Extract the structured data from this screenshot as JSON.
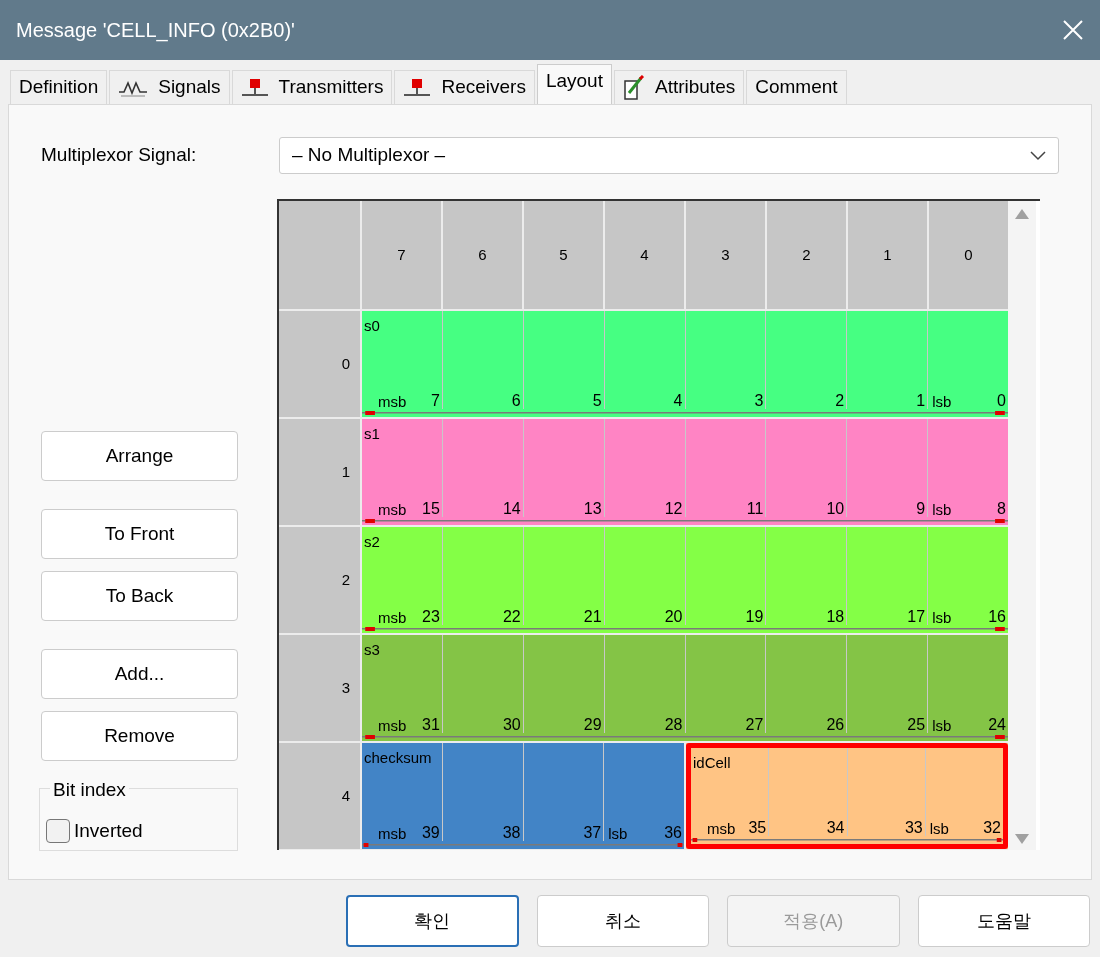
{
  "window": {
    "title": "Message 'CELL_INFO (0x2B0)'"
  },
  "tabs": [
    {
      "label": "Definition",
      "kind": "plain",
      "selected": false
    },
    {
      "label": "Signals",
      "kind": "signal",
      "selected": false
    },
    {
      "label": "Transmitters",
      "kind": "node",
      "selected": false
    },
    {
      "label": "Receivers",
      "kind": "node",
      "selected": false
    },
    {
      "label": "Layout",
      "kind": "plain",
      "selected": true
    },
    {
      "label": "Attributes",
      "kind": "attribute",
      "selected": false
    },
    {
      "label": "Comment",
      "kind": "plain",
      "selected": false
    }
  ],
  "multiplexor": {
    "label": "Multiplexor Signal:",
    "value": "– No Multiplexor –"
  },
  "action_groups": [
    [
      "Arrange"
    ],
    [
      "To Front",
      "To Back"
    ],
    [
      "Add...",
      "Remove"
    ]
  ],
  "bit_index": {
    "title": "Bit index",
    "inverted_label": "Inverted",
    "inverted": false
  },
  "layout": {
    "column_headers": [
      "7",
      "6",
      "5",
      "4",
      "3",
      "2",
      "1",
      "0"
    ],
    "rows": [
      {
        "label": "0",
        "segments": [
          {
            "name": "s0",
            "color": "#46ff82",
            "highlighted": false,
            "cells": [
              {
                "bit": "7",
                "end": "msb"
              },
              {
                "bit": "6"
              },
              {
                "bit": "5"
              },
              {
                "bit": "4"
              },
              {
                "bit": "3"
              },
              {
                "bit": "2"
              },
              {
                "bit": "1"
              },
              {
                "bit": "0",
                "end": "lsb"
              }
            ]
          }
        ]
      },
      {
        "label": "1",
        "segments": [
          {
            "name": "s1",
            "color": "#ff84c4",
            "highlighted": false,
            "cells": [
              {
                "bit": "15",
                "end": "msb"
              },
              {
                "bit": "14"
              },
              {
                "bit": "13"
              },
              {
                "bit": "12"
              },
              {
                "bit": "11"
              },
              {
                "bit": "10"
              },
              {
                "bit": "9"
              },
              {
                "bit": "8",
                "end": "lsb"
              }
            ]
          }
        ]
      },
      {
        "label": "2",
        "segments": [
          {
            "name": "s2",
            "color": "#84ff46",
            "highlighted": false,
            "cells": [
              {
                "bit": "23",
                "end": "msb"
              },
              {
                "bit": "22"
              },
              {
                "bit": "21"
              },
              {
                "bit": "20"
              },
              {
                "bit": "19"
              },
              {
                "bit": "18"
              },
              {
                "bit": "17"
              },
              {
                "bit": "16",
                "end": "lsb"
              }
            ]
          }
        ]
      },
      {
        "label": "3",
        "segments": [
          {
            "name": "s3",
            "color": "#84c446",
            "highlighted": false,
            "cells": [
              {
                "bit": "31",
                "end": "msb"
              },
              {
                "bit": "30"
              },
              {
                "bit": "29"
              },
              {
                "bit": "28"
              },
              {
                "bit": "27"
              },
              {
                "bit": "26"
              },
              {
                "bit": "25"
              },
              {
                "bit": "24",
                "end": "lsb"
              }
            ]
          }
        ]
      },
      {
        "label": "4",
        "segments": [
          {
            "name": "checksum",
            "color": "#4284c6",
            "highlighted": false,
            "cells": [
              {
                "bit": "39",
                "end": "msb"
              },
              {
                "bit": "38"
              },
              {
                "bit": "37"
              },
              {
                "bit": "36",
                "end": "lsb"
              }
            ]
          },
          {
            "name": "idCell",
            "color": "#ffc484",
            "highlighted": true,
            "cells": [
              {
                "bit": "35",
                "end": "msb"
              },
              {
                "bit": "34"
              },
              {
                "bit": "33"
              },
              {
                "bit": "32",
                "end": "lsb"
              }
            ]
          }
        ]
      }
    ]
  },
  "buttons": [
    {
      "label": "확인",
      "default": true,
      "disabled": false
    },
    {
      "label": "취소",
      "default": false,
      "disabled": false
    },
    {
      "label": "적용(A)",
      "default": false,
      "disabled": true
    },
    {
      "label": "도움말",
      "default": false,
      "disabled": false
    }
  ]
}
